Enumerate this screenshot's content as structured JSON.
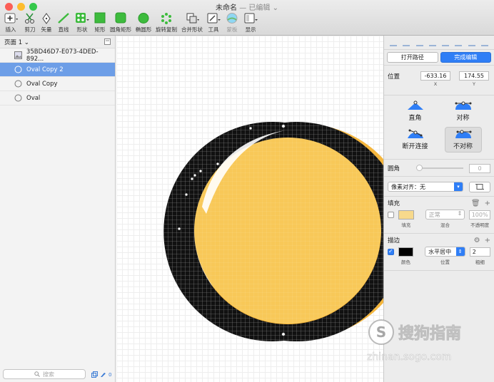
{
  "window": {
    "title": "未命名",
    "title_suffix": "— 已编辑 ⌄",
    "traffic_lights": [
      "#fc5f57",
      "#fdbc2e",
      "#34c84a"
    ]
  },
  "toolbar": {
    "items": [
      {
        "label": "插入",
        "icon": "plus-icon"
      },
      {
        "label": "剪刀",
        "icon": "scissors-icon"
      },
      {
        "label": "矢量",
        "icon": "pen-icon"
      },
      {
        "label": "直线",
        "icon": "line-icon"
      },
      {
        "label": "形状",
        "icon": "shapes-icon"
      },
      {
        "label": "矩形",
        "icon": "rectangle-icon"
      },
      {
        "label": "圆角矩形",
        "icon": "rounded-rectangle-icon"
      },
      {
        "label": "椭圆形",
        "icon": "oval-icon"
      },
      {
        "label": "旋转复制",
        "icon": "rotate-copy-icon"
      },
      {
        "label": "合并形状",
        "icon": "combine-icon"
      },
      {
        "label": "工具",
        "icon": "tools-icon"
      },
      {
        "label": "蒙板",
        "icon": "mask-icon"
      },
      {
        "label": "显示",
        "icon": "view-icon"
      }
    ],
    "accent_green": "#3dbb3d"
  },
  "sidebar": {
    "page_label": "页面 1 ⌄",
    "layers": [
      {
        "name": "35BD46D7-E073-4DED-892...",
        "icon": "image-icon",
        "selected": false
      },
      {
        "name": "Oval Copy 2",
        "icon": "oval-icon",
        "selected": true
      },
      {
        "name": "Oval Copy",
        "icon": "oval-icon",
        "selected": false
      },
      {
        "name": "Oval",
        "icon": "oval-icon",
        "selected": false
      }
    ],
    "search_placeholder": "搜索",
    "edit_count": "0"
  },
  "inspector": {
    "open_path": "打开路径",
    "finish_edit": "完成编辑",
    "position_label": "位置",
    "x_value": "-633.16",
    "y_value": "174.55",
    "x_caption": "X",
    "y_caption": "Y",
    "point_types": [
      {
        "label": "直角",
        "icon": "straight-point-icon",
        "selected": false
      },
      {
        "label": "对称",
        "icon": "mirrored-point-icon",
        "selected": false
      },
      {
        "label": "断开连接",
        "icon": "disconnected-point-icon",
        "selected": false
      },
      {
        "label": "不对称",
        "icon": "asymmetric-point-icon",
        "selected": true
      }
    ],
    "corner_label": "圆角",
    "corner_value": "0",
    "pixel_align": "像素对齐：无",
    "fill_header": "填充",
    "fill_color": "#f7d98c",
    "fill_mode": "正常",
    "fill_opacity": "100%",
    "fill_caption": "填充",
    "blend_caption": "混合",
    "opacity_caption": "不透明度",
    "border_header": "描边",
    "border_color": "#000000",
    "border_position": "水平居中",
    "border_width": "2",
    "border_color_caption": "颜色",
    "border_position_caption": "位置",
    "border_width_caption": "粗细"
  },
  "canvas": {
    "oval_back_color": "#f4b63e",
    "oval_front_color": "#f8c858",
    "ring_color": "#000000"
  },
  "watermark": {
    "brand": "搜狗指南",
    "url": "zhinan.sogo.com"
  }
}
